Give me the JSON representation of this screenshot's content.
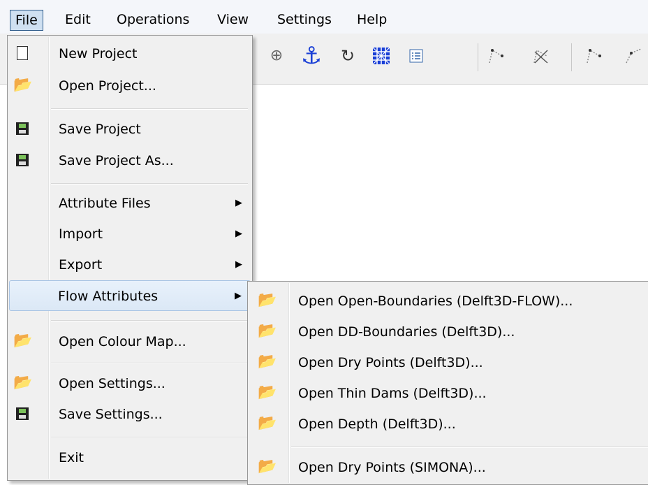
{
  "menubar": {
    "items": [
      "File",
      "Edit",
      "Operations",
      "View",
      "Settings",
      "Help"
    ]
  },
  "file_menu": {
    "new_project": "New Project",
    "open_project": "Open Project...",
    "save_project": "Save Project",
    "save_project_as": "Save Project As...",
    "attribute_files": "Attribute Files",
    "import": "Import",
    "export": "Export",
    "flow_attributes": "Flow Attributes",
    "open_colour_map": "Open Colour Map...",
    "open_settings": "Open Settings...",
    "save_settings": "Save Settings...",
    "exit": "Exit"
  },
  "flow_submenu": {
    "items": [
      "Open Open-Boundaries (Delft3D-FLOW)...",
      "Open DD-Boundaries (Delft3D)...",
      "Open Dry Points (Delft3D)...",
      "Open Thin Dams (Delft3D)...",
      "Open Depth (Delft3D)...",
      "Open Dry Points (SIMONA)..."
    ]
  },
  "colors": {
    "highlight": "#dbe8f6",
    "anchor": "#1a3fd6",
    "menu_bg": "#f0f0f0"
  }
}
